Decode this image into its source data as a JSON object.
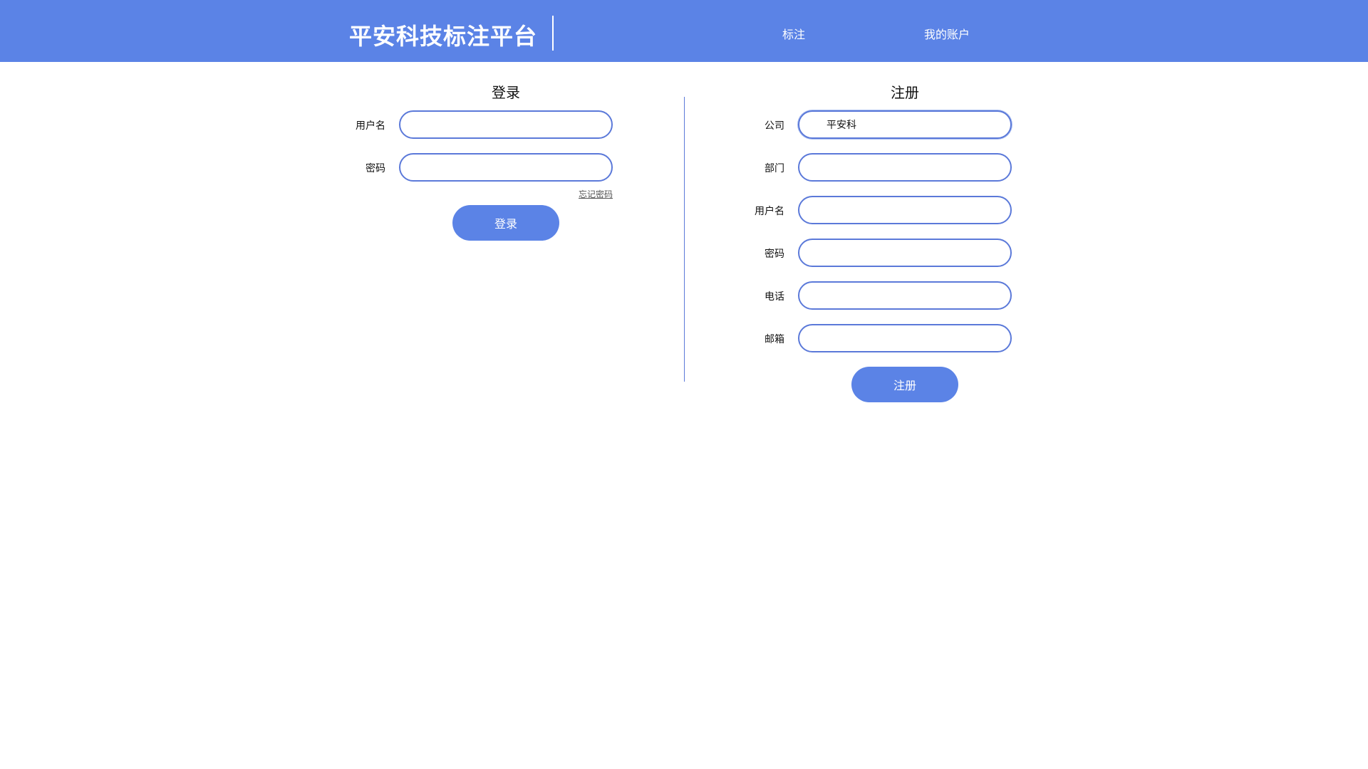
{
  "header": {
    "logo_text": "平安科技标注平台",
    "nav": {
      "annotate": "标注",
      "account": "我的账户"
    }
  },
  "login": {
    "title": "登录",
    "username_label": "用户名",
    "username_value": "",
    "password_label": "密码",
    "password_value": "",
    "forgot_password": "忘记密码",
    "submit_label": "登录"
  },
  "register": {
    "title": "注册",
    "company_label": "公司",
    "company_value": "平安科",
    "department_label": "部门",
    "department_value": "",
    "username_label": "用户名",
    "username_value": "",
    "password_label": "密码",
    "password_value": "",
    "phone_label": "电话",
    "phone_value": "",
    "email_label": "邮箱",
    "email_value": "",
    "submit_label": "注册"
  },
  "colors": {
    "brand": "#5b83e6",
    "input_border": "#5b79d9",
    "background": "#ffffff"
  }
}
